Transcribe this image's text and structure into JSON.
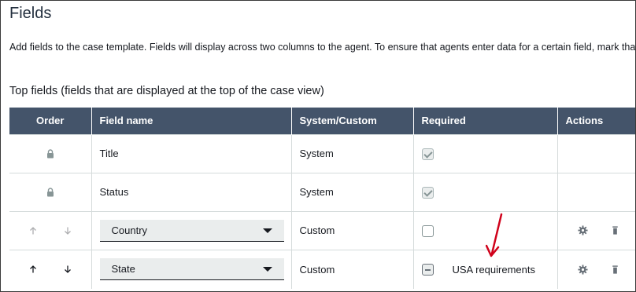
{
  "page": {
    "title": "Fields",
    "description": "Add fields to the case template. Fields will display across two columns to the agent. To ensure that agents enter data for a certain field, mark that field as required.",
    "section_title": "Top fields (fields that are displayed at the top of the case view)"
  },
  "table": {
    "headers": {
      "order": "Order",
      "field_name": "Field name",
      "system_custom": "System/Custom",
      "required": "Required",
      "actions": "Actions"
    },
    "rows": [
      {
        "field_name": "Title",
        "type": "System",
        "required_state": "checked-disabled",
        "required_label": ""
      },
      {
        "field_name": "Status",
        "type": "System",
        "required_state": "checked-disabled",
        "required_label": ""
      },
      {
        "field_name": "Country",
        "type": "Custom",
        "required_state": "unchecked",
        "required_label": ""
      },
      {
        "field_name": "State",
        "type": "Custom",
        "required_state": "indeterminate",
        "required_label": "USA requirements"
      }
    ]
  },
  "colors": {
    "header_bg": "#44546a",
    "annotation": "#d0021b"
  },
  "icons": [
    "lock-icon",
    "arrow-up-icon",
    "arrow-down-icon",
    "chevron-down-icon",
    "gear-icon",
    "trash-icon",
    "annotation-arrow"
  ]
}
